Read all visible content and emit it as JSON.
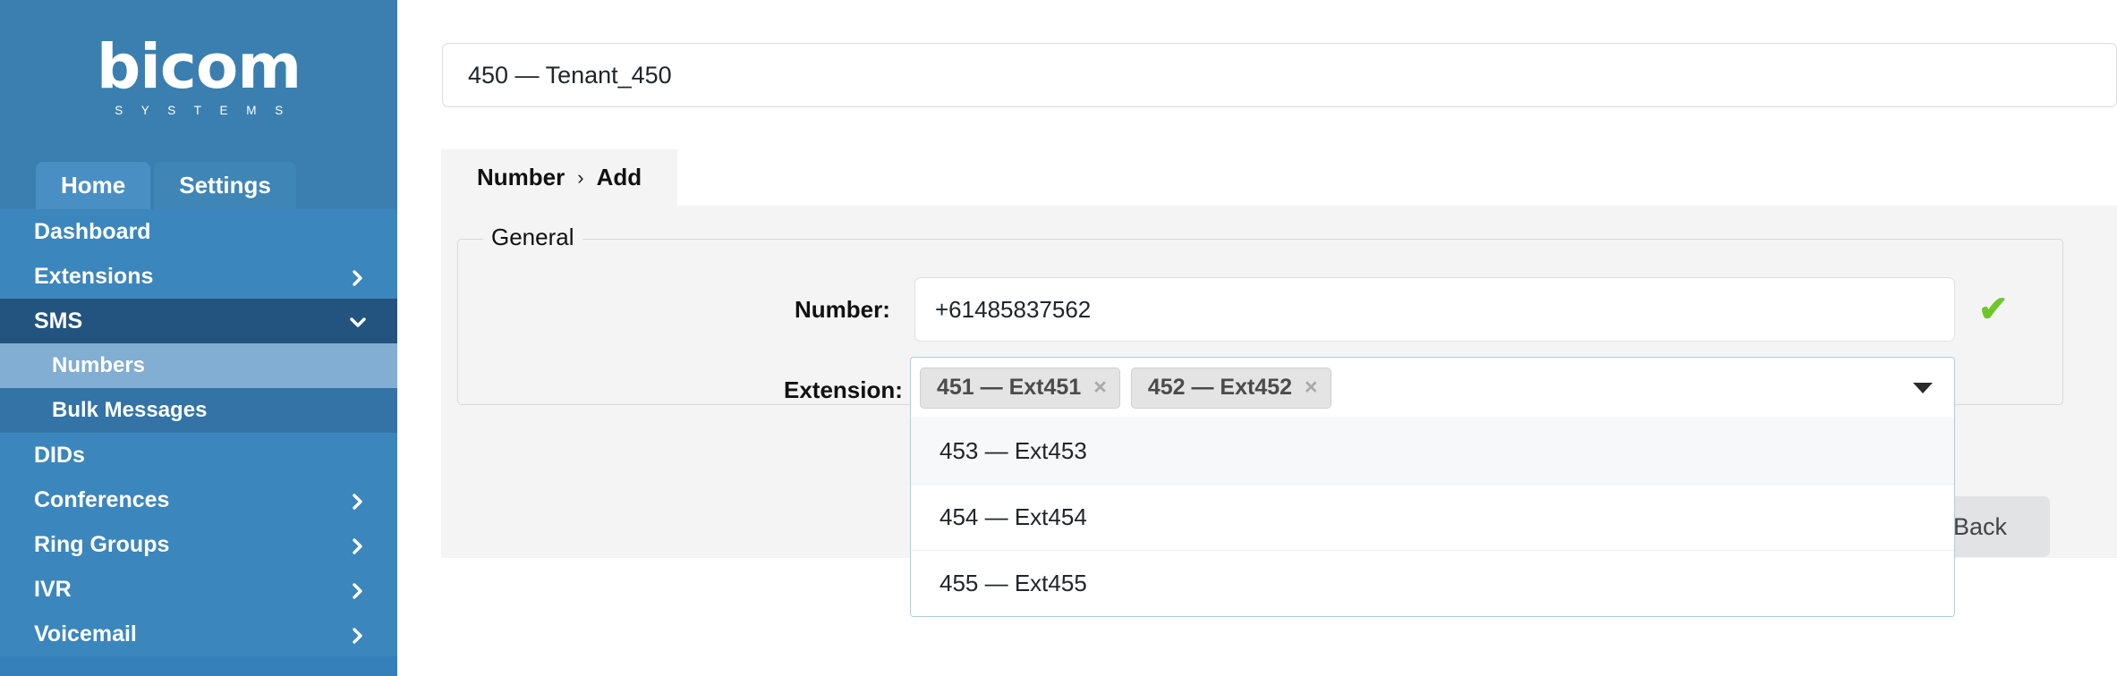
{
  "brand": {
    "logo_text": "bicom",
    "logo_subtitle": "S Y S T E M S",
    "sidebar_bg": "#3580ba",
    "sidebar_open_bg": "#23547f",
    "sidebar_active_bg": "#81aed2",
    "success_color": "#6ec72a"
  },
  "sidebar": {
    "tabs": [
      {
        "label": "Home",
        "active": true
      },
      {
        "label": "Settings",
        "active": false
      }
    ],
    "items": [
      {
        "label": "Dashboard",
        "chevron": "",
        "state": "normal"
      },
      {
        "label": "Extensions",
        "chevron": "right",
        "state": "normal"
      },
      {
        "label": "SMS",
        "chevron": "down",
        "state": "open"
      },
      {
        "label": "Numbers",
        "chevron": "",
        "state": "sub-active"
      },
      {
        "label": "Bulk Messages",
        "chevron": "",
        "state": "sub"
      },
      {
        "label": "DIDs",
        "chevron": "",
        "state": "normal"
      },
      {
        "label": "Conferences",
        "chevron": "right",
        "state": "normal"
      },
      {
        "label": "Ring Groups",
        "chevron": "right",
        "state": "normal"
      },
      {
        "label": "IVR",
        "chevron": "right",
        "state": "normal"
      },
      {
        "label": "Voicemail",
        "chevron": "right",
        "state": "normal"
      }
    ]
  },
  "tenant": {
    "value": "450  —  Tenant_450"
  },
  "breadcrumb": {
    "root": "Number",
    "separator": "›",
    "current": "Add"
  },
  "form": {
    "legend": "General",
    "number": {
      "label": "Number:",
      "value": "+61485837562",
      "valid_icon": "✔"
    },
    "extension": {
      "label": "Extension:",
      "tags": [
        {
          "text": "451  —  Ext451",
          "remove": "×"
        },
        {
          "text": "452  —  Ext452",
          "remove": "×"
        }
      ],
      "options": [
        {
          "text": "453  —  Ext453",
          "highlighted": true
        },
        {
          "text": "454  —  Ext454",
          "highlighted": false
        },
        {
          "text": "455  —  Ext455",
          "highlighted": false
        }
      ]
    }
  },
  "actions": {
    "back_label": "Back"
  }
}
